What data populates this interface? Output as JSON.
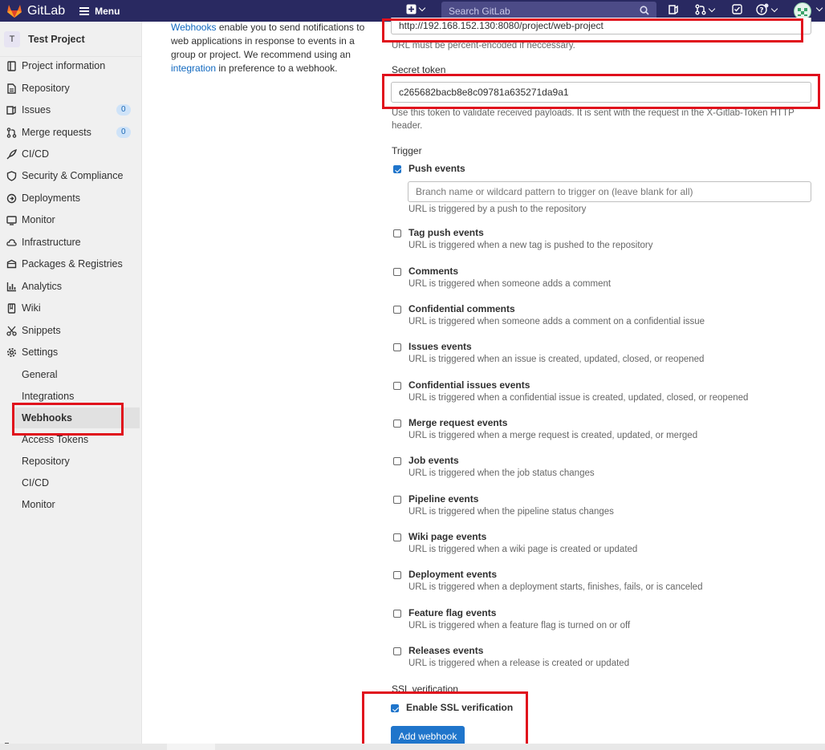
{
  "topbar": {
    "app_name": "GitLab",
    "menu_label": "Menu",
    "search_placeholder": "Search GitLab"
  },
  "sidebar": {
    "project_initial": "T",
    "project_name": "Test Project",
    "items": [
      {
        "label": "Project information",
        "icon": "info-icon"
      },
      {
        "label": "Repository",
        "icon": "doc-icon"
      },
      {
        "label": "Issues",
        "icon": "issues-icon",
        "count": "0"
      },
      {
        "label": "Merge requests",
        "icon": "merge-request-icon",
        "count": "0"
      },
      {
        "label": "CI/CD",
        "icon": "rocket-icon"
      },
      {
        "label": "Security & Compliance",
        "icon": "shield-icon"
      },
      {
        "label": "Deployments",
        "icon": "deployments-icon"
      },
      {
        "label": "Monitor",
        "icon": "monitor-icon"
      },
      {
        "label": "Infrastructure",
        "icon": "cloud-icon"
      },
      {
        "label": "Packages & Registries",
        "icon": "package-icon"
      },
      {
        "label": "Analytics",
        "icon": "chart-icon"
      },
      {
        "label": "Wiki",
        "icon": "book-icon"
      },
      {
        "label": "Snippets",
        "icon": "scissors-icon"
      },
      {
        "label": "Settings",
        "icon": "gear-icon"
      }
    ],
    "settings_sub": [
      "General",
      "Integrations",
      "Webhooks",
      "Access Tokens",
      "Repository",
      "CI/CD",
      "Monitor"
    ],
    "active_sub": "Webhooks"
  },
  "intro": {
    "link1": "Webhooks",
    "text1": " enable you to send notifications to web applications in response to events in a group or project. We recommend using an ",
    "link2": "integration",
    "text2": " in preference to a webhook."
  },
  "form": {
    "url_value": "http://192.168.152.130:8080/project/web-project",
    "url_help": "URL must be percent-encoded if neccessary.",
    "secret_label": "Secret token",
    "secret_value": "c265682bacb8e8c09781a635271da9a1",
    "secret_help": "Use this token to validate received payloads. It is sent with the request in the X-Gitlab-Token HTTP header.",
    "trigger_label": "Trigger",
    "push_branch_placeholder": "Branch name or wildcard pattern to trigger on (leave blank for all)",
    "triggers": [
      {
        "title": "Push events",
        "desc": "URL is triggered by a push to the repository",
        "checked": true
      },
      {
        "title": "Tag push events",
        "desc": "URL is triggered when a new tag is pushed to the repository",
        "checked": false
      },
      {
        "title": "Comments",
        "desc": "URL is triggered when someone adds a comment",
        "checked": false
      },
      {
        "title": "Confidential comments",
        "desc": "URL is triggered when someone adds a comment on a confidential issue",
        "checked": false
      },
      {
        "title": "Issues events",
        "desc": "URL is triggered when an issue is created, updated, closed, or reopened",
        "checked": false
      },
      {
        "title": "Confidential issues events",
        "desc": "URL is triggered when a confidential issue is created, updated, closed, or reopened",
        "checked": false
      },
      {
        "title": "Merge request events",
        "desc": "URL is triggered when a merge request is created, updated, or merged",
        "checked": false
      },
      {
        "title": "Job events",
        "desc": "URL is triggered when the job status changes",
        "checked": false
      },
      {
        "title": "Pipeline events",
        "desc": "URL is triggered when the pipeline status changes",
        "checked": false
      },
      {
        "title": "Wiki page events",
        "desc": "URL is triggered when a wiki page is created or updated",
        "checked": false
      },
      {
        "title": "Deployment events",
        "desc": "URL is triggered when a deployment starts, finishes, fails, or is canceled",
        "checked": false
      },
      {
        "title": "Feature flag events",
        "desc": "URL is triggered when a feature flag is turned on or off",
        "checked": false
      },
      {
        "title": "Releases events",
        "desc": "URL is triggered when a release is created or updated",
        "checked": false
      }
    ],
    "ssl_label": "SSL verification",
    "ssl_checkbox_label": "Enable SSL verification",
    "ssl_checked": true,
    "submit_label": "Add webhook"
  },
  "colors": {
    "topbar": "#292961",
    "primary": "#1f75cb",
    "highlight": "#e0101c"
  }
}
